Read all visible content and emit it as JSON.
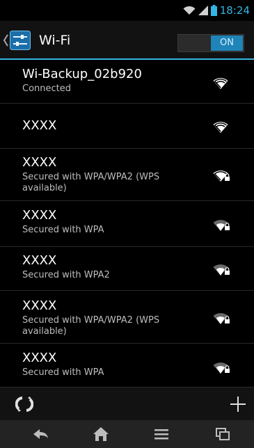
{
  "status_bar": {
    "time": "18:24",
    "icons": [
      "wifi-icon",
      "cell-signal-icon",
      "battery-icon"
    ],
    "accent": "#33b5e5"
  },
  "action_bar": {
    "title": "Wi-Fi",
    "toggle_label": "ON",
    "icon": "wifi-settings-icon"
  },
  "networks": [
    {
      "ssid": "Wi-Backup_02b920",
      "detail": "Connected",
      "secured": false,
      "strength": "full"
    },
    {
      "ssid": "XXXX",
      "detail": "",
      "secured": false,
      "strength": "full"
    },
    {
      "ssid": "XXXX",
      "detail": "Secured with WPA/WPA2 (WPS available)",
      "secured": true,
      "strength": "full"
    },
    {
      "ssid": "XXXX",
      "detail": "Secured with WPA",
      "secured": true,
      "strength": "medium"
    },
    {
      "ssid": "XXXX",
      "detail": "Secured with WPA2",
      "secured": true,
      "strength": "medium"
    },
    {
      "ssid": "XXXX",
      "detail": "Secured with WPA/WPA2 (WPS available)",
      "secured": true,
      "strength": "medium"
    },
    {
      "ssid": "XXXX",
      "detail": "Secured with WPA",
      "secured": true,
      "strength": "medium"
    }
  ],
  "bottom_bar": {
    "left_icon": "wps-push-icon",
    "right_icon": "add-network-icon"
  },
  "nav_bar": {
    "buttons": [
      "back-icon",
      "home-icon",
      "menu-icon",
      "recent-apps-icon"
    ]
  },
  "colors": {
    "accent": "#33b5e5",
    "toggle_on": "#1f84b8",
    "background": "#000000"
  }
}
